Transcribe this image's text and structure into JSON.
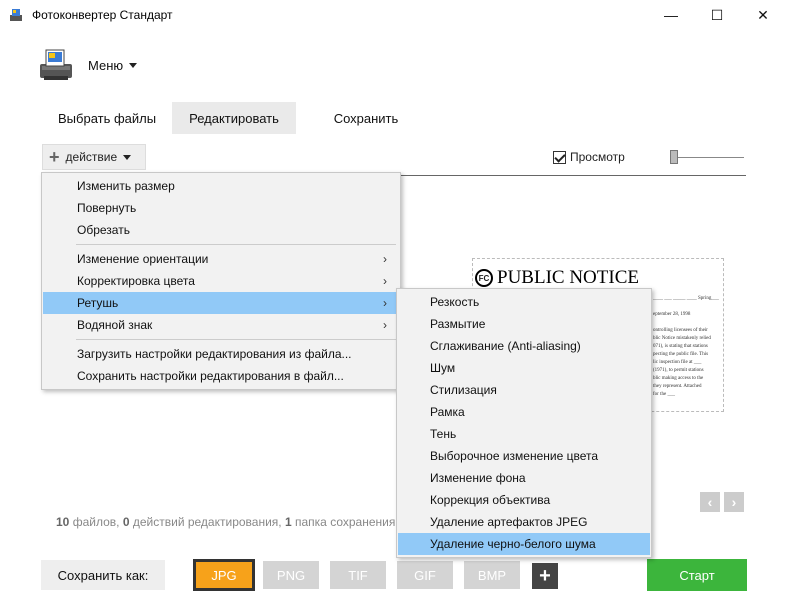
{
  "window": {
    "title": "Фотоконвертер Стандарт",
    "min_glyph": "—",
    "max_glyph": "☐",
    "close_glyph": "✕"
  },
  "header": {
    "menu_label": "Меню"
  },
  "tabs": [
    {
      "label": "Выбрать файлы"
    },
    {
      "label": "Редактировать"
    },
    {
      "label": "Сохранить"
    }
  ],
  "toolbar": {
    "action_label": "действие",
    "preview_label": "Просмотр",
    "preview_checked": true
  },
  "action_menu": {
    "items": [
      {
        "label": "Изменить размер"
      },
      {
        "label": "Повернуть"
      },
      {
        "label": "Обрезать"
      },
      {
        "label": "Изменение ориентации"
      },
      {
        "label": "Корректировка цвета"
      },
      {
        "label": "Ретушь"
      },
      {
        "label": "Водяной знак"
      },
      {
        "label": "Загрузить настройки редактирования из файла..."
      },
      {
        "label": "Сохранить настройки редактирования в файл..."
      }
    ],
    "submenu_arrow": "›"
  },
  "retouch_menu": {
    "items": [
      {
        "label": "Резкость"
      },
      {
        "label": "Размытие"
      },
      {
        "label": "Сглаживание (Anti-aliasing)"
      },
      {
        "label": "Шум"
      },
      {
        "label": "Стилизация"
      },
      {
        "label": "Рамка"
      },
      {
        "label": "Тень"
      },
      {
        "label": "Выборочное изменение цвета"
      },
      {
        "label": "Изменение фона"
      },
      {
        "label": "Коррекция объектива"
      },
      {
        "label": "Удаление артефактов JPEG"
      },
      {
        "label": "Удаление черно-белого шума"
      }
    ]
  },
  "preview_image": {
    "logo_text": "FC",
    "title": "PUBLIC NOTICE",
    "lines": [
      "____  ___ _____ ____  Spring___",
      "",
      "eptember 28, 1998",
      "",
      "ontrolling licensees of their",
      "blic Notice mistakenly relied",
      "071), is stating that stations",
      "pecting the public file. This",
      "lic inspection file at ___",
      "(1971), to permit stations",
      "blic making access to the",
      "they represent. Attached",
      "for the ___"
    ]
  },
  "nav": {
    "prev": "‹",
    "next": "›"
  },
  "status": {
    "files_count": "10",
    "files_label": "файлов,",
    "actions_count": "0",
    "actions_label": "действий редактирования,",
    "folders_count": "1",
    "folders_label": "папка сохранения"
  },
  "bottom": {
    "save_as_label": "Сохранить как:",
    "formats": [
      "JPG",
      "PNG",
      "TIF",
      "GIF",
      "BMP"
    ],
    "add_label": "+",
    "start_label": "Старт"
  },
  "colors": {
    "accent_format": "#f7a21a",
    "start": "#3cb53c",
    "menu_highlight": "#91c9f7"
  }
}
